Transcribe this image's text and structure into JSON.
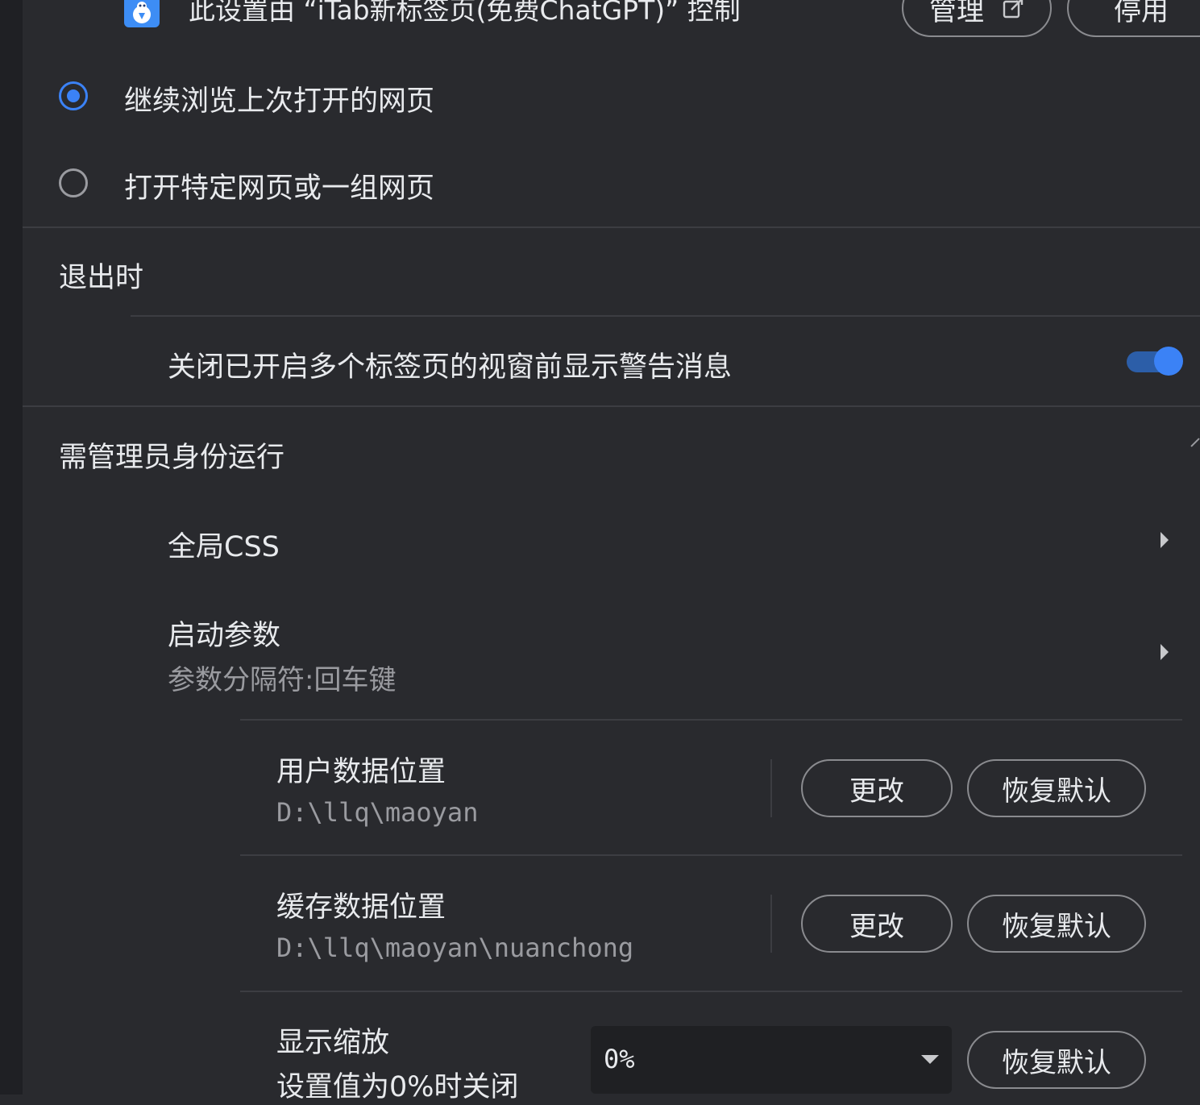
{
  "extension_control": {
    "text": "此设置由 “iTab新标签页(免费ChatGPT)” 控制",
    "manage_label": "管理",
    "disable_label": "停用"
  },
  "startup": {
    "options": [
      {
        "label": "继续浏览上次打开的网页",
        "selected": true
      },
      {
        "label": "打开特定网页或一组网页",
        "selected": false
      }
    ]
  },
  "on_exit": {
    "heading": "退出时",
    "warn_close_label": "关闭已开启多个标签页的视窗前显示警告消息",
    "warn_close_enabled": true
  },
  "admin": {
    "heading": "需管理员身份运行"
  },
  "global_css": {
    "label": "全局CSS"
  },
  "launch_params": {
    "label": "启动参数",
    "hint": "参数分隔符:回车键"
  },
  "user_data": {
    "label": "用户数据位置",
    "path": "D:\\llq\\maoyan",
    "change_label": "更改",
    "reset_label": "恢复默认"
  },
  "cache_data": {
    "label": "缓存数据位置",
    "path": "D:\\llq\\maoyan\\nuanchong",
    "change_label": "更改",
    "reset_label": "恢复默认"
  },
  "display_zoom": {
    "label": "显示缩放",
    "hint": "设置值为0%时关闭",
    "value": "0%",
    "reset_label": "恢复默认"
  },
  "colors": {
    "accent": "#3b82f6",
    "background": "#292a2e"
  }
}
